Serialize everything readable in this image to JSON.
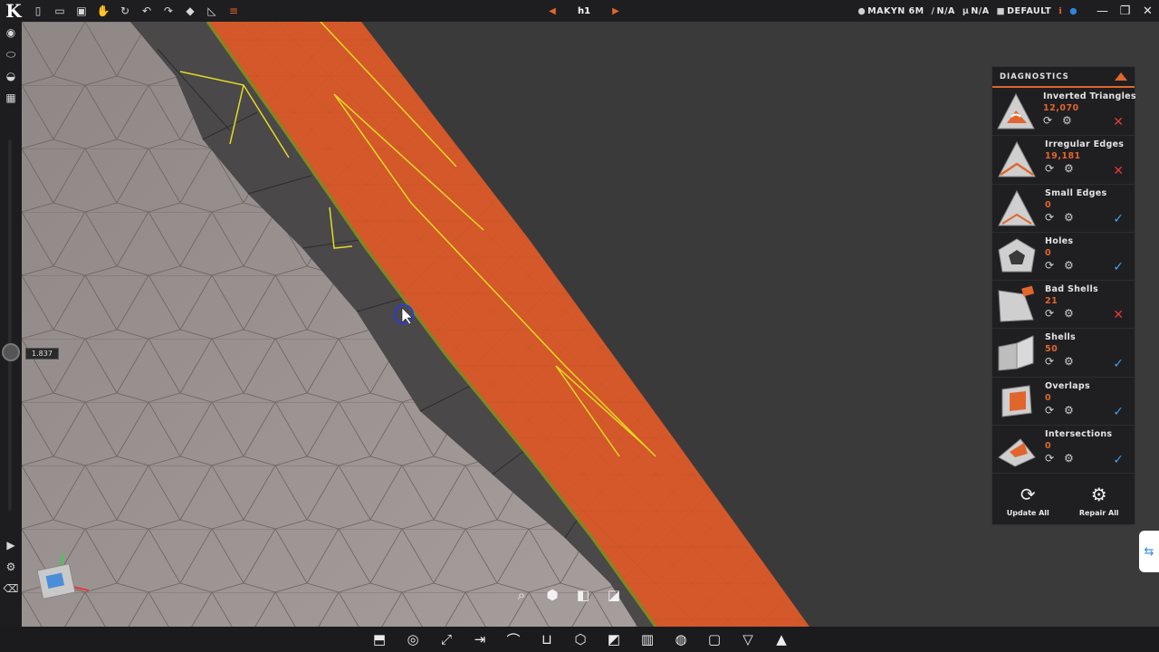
{
  "app": {
    "logo": "K"
  },
  "toolbar": {
    "icons": [
      "new-file-icon",
      "open-folder-icon",
      "save-icon",
      "pan-hand-icon",
      "rotate-icon",
      "undo-icon",
      "redo-icon",
      "marker-icon",
      "measure-icon",
      "dropdown-icon"
    ]
  },
  "document_nav": {
    "name": "h1",
    "prev_glyph": "◀",
    "next_glyph": "▶"
  },
  "status": {
    "makyn": "MAKYN 6M",
    "na1": "N/A",
    "na2": "N/A",
    "profile": "DEFAULT",
    "info_glyph": "ℹ"
  },
  "window": {
    "minimize": "—",
    "maximize": "❐",
    "close": "✕"
  },
  "viewport": {
    "value_label": "1.837"
  },
  "diagnostics": {
    "title": "DIAGNOSTICS",
    "items": [
      {
        "name": "Inverted Triangles",
        "count": "12,070",
        "status": "bad",
        "status_glyph": "✕"
      },
      {
        "name": "Irregular Edges",
        "count": "19,181",
        "status": "bad",
        "status_glyph": "✕"
      },
      {
        "name": "Small Edges",
        "count": "0",
        "status": "ok",
        "status_glyph": "✓"
      },
      {
        "name": "Holes",
        "count": "0",
        "status": "ok",
        "status_glyph": "✓"
      },
      {
        "name": "Bad Shells",
        "count": "21",
        "status": "bad",
        "status_glyph": "✕"
      },
      {
        "name": "Shells",
        "count": "50",
        "status": "ok",
        "status_glyph": "✓"
      },
      {
        "name": "Overlaps",
        "count": "0",
        "status": "ok",
        "status_glyph": "✓"
      },
      {
        "name": "Intersections",
        "count": "0",
        "status": "ok",
        "status_glyph": "✓"
      }
    ],
    "update_all": "Update All",
    "repair_all": "Repair All"
  },
  "colors": {
    "accent": "#e0662e",
    "ok": "#3fa0e8",
    "bad": "#e23a3a",
    "mesh_orange": "#d4582a",
    "mesh_grey": "#9a9190"
  }
}
